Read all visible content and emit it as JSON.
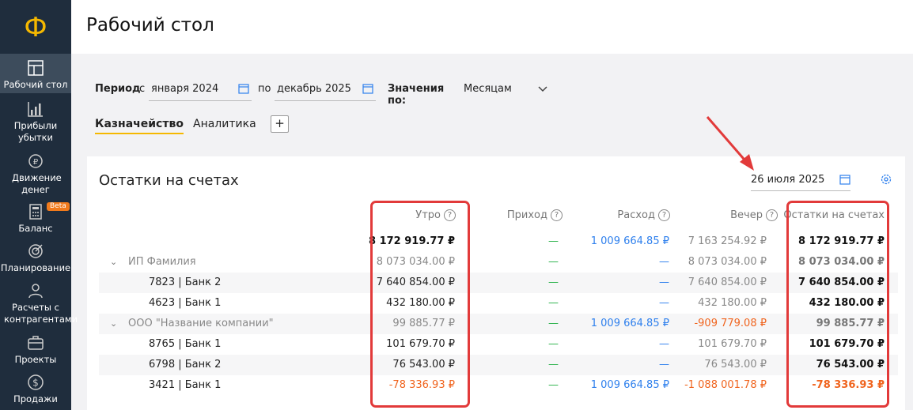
{
  "sidebar": {
    "logo": "Ф",
    "items": [
      {
        "label": "Рабочий стол",
        "icon": "dashboard-icon",
        "active": true
      },
      {
        "label": "Прибыли убытки",
        "icon": "bar-chart-icon"
      },
      {
        "label": "Движение денег",
        "icon": "money-flow-icon"
      },
      {
        "label": "Баланс",
        "icon": "calculator-icon",
        "badge": "Beta"
      },
      {
        "label": "Планирование",
        "icon": "target-icon"
      },
      {
        "label": "Расчеты с контрагентами",
        "icon": "people-icon"
      },
      {
        "label": "Проекты",
        "icon": "briefcase-icon"
      },
      {
        "label": "Продажи",
        "icon": "dollar-icon"
      }
    ]
  },
  "header": {
    "title": "Рабочий стол"
  },
  "filters": {
    "period_label": "Период",
    "from_prefix": "с",
    "from_value": "января 2024",
    "to_prefix": "по",
    "to_value": "декабрь 2025",
    "values_by_label": "Значения по:",
    "values_by_value": "Месяцам"
  },
  "tabs": [
    {
      "label": "Казначейство",
      "active": true
    },
    {
      "label": "Аналитика"
    }
  ],
  "add_tab_label": "+",
  "card": {
    "title": "Остатки на счетах",
    "date": "26 июля 2025",
    "columns": {
      "morning": "Утро",
      "income": "Приход",
      "expense": "Расход",
      "evening": "Вечер",
      "balance": "Остатки на счетах"
    },
    "help_glyph": "?"
  },
  "rows": [
    {
      "name": "",
      "morning": "8 172 919.77 ₽",
      "income": "—",
      "expense": "1 009 664.85 ₽",
      "evening": "7 163 254.92 ₽",
      "balance": "8 172 919.77 ₽"
    },
    {
      "name": "ИП Фамилия",
      "morning": "8 073 034.00 ₽",
      "income": "—",
      "expense": "—",
      "evening": "8 073 034.00 ₽",
      "balance": "8 073 034.00 ₽"
    },
    {
      "name": "7823 | Банк 2",
      "morning": "7 640 854.00 ₽",
      "income": "—",
      "expense": "—",
      "evening": "7 640 854.00 ₽",
      "balance": "7 640 854.00 ₽"
    },
    {
      "name": "4623 | Банк 1",
      "morning": "432 180.00 ₽",
      "income": "—",
      "expense": "—",
      "evening": "432 180.00 ₽",
      "balance": "432 180.00 ₽"
    },
    {
      "name": "ООО \"Название компании\"",
      "morning": "99 885.77 ₽",
      "income": "—",
      "expense": "1 009 664.85 ₽",
      "evening": "-909 779.08 ₽",
      "balance": "99 885.77 ₽"
    },
    {
      "name": "8765 | Банк 1",
      "morning": "101 679.70 ₽",
      "income": "—",
      "expense": "—",
      "evening": "101 679.70 ₽",
      "balance": "101 679.70 ₽"
    },
    {
      "name": "6798 | Банк 2",
      "morning": "76 543.00 ₽",
      "income": "—",
      "expense": "—",
      "evening": "76 543.00 ₽",
      "balance": "76 543.00 ₽"
    },
    {
      "name": "3421 | Банк 1",
      "morning": "-78 336.93 ₽",
      "income": "—",
      "expense": "1 009 664.85 ₽",
      "evening": "-1 088 001.78 ₽",
      "balance": "-78 336.93 ₽"
    }
  ],
  "colors": {
    "sidebar": "#1f2d3d",
    "accent": "#f5b800",
    "positive": "#2bb34b",
    "link": "#2f80ed",
    "negative": "#f0641e",
    "annotation": "#e23a3a"
  }
}
